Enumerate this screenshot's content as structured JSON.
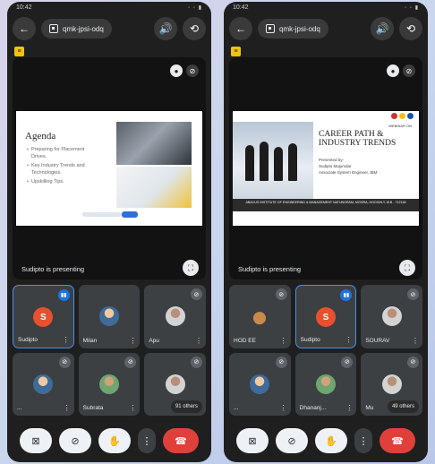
{
  "screens": [
    {
      "status_time": "10:42",
      "meeting_code": "qmk-jpsi-odq",
      "presenting_label": "Sudipto is presenting",
      "slide": {
        "title": "Agenda",
        "bullets": [
          "Preparing for Placement Drives.",
          "Key Industry Trends and Technologies.",
          "Upskilling Tips."
        ]
      },
      "tiles": [
        {
          "name": "Sudipto",
          "initial": "S",
          "speaking": true
        },
        {
          "name": "Milan"
        },
        {
          "name": "Apu"
        },
        {
          "name": "..."
        },
        {
          "name": "Subrata"
        },
        {
          "name": "",
          "others": "91 others"
        }
      ]
    },
    {
      "status_time": "10:42",
      "meeting_code": "qmk-jpsi-odq",
      "presenting_label": "Sudipto is presenting",
      "slide": {
        "small": "WEBINAR ON",
        "title": "CAREER PATH & INDUSTRY TRENDS",
        "presenter_lines": [
          "Presented by-",
          "Sudipto Majumdar",
          "Associate System Engineer, IBM"
        ],
        "banner": "ABACUS INSTITUTE OF ENGINEERING & MANAGEMENT NATUNGRAM, MOGRA, HOOGHLY, W.B - 712148"
      },
      "tiles": [
        {
          "name": "HOD EE"
        },
        {
          "name": "Sudipto",
          "initial": "S",
          "speaking": true
        },
        {
          "name": "SOURAV"
        },
        {
          "name": "..."
        },
        {
          "name": "Dhananj..."
        },
        {
          "name": "Mu",
          "others": "49 others"
        }
      ]
    }
  ]
}
